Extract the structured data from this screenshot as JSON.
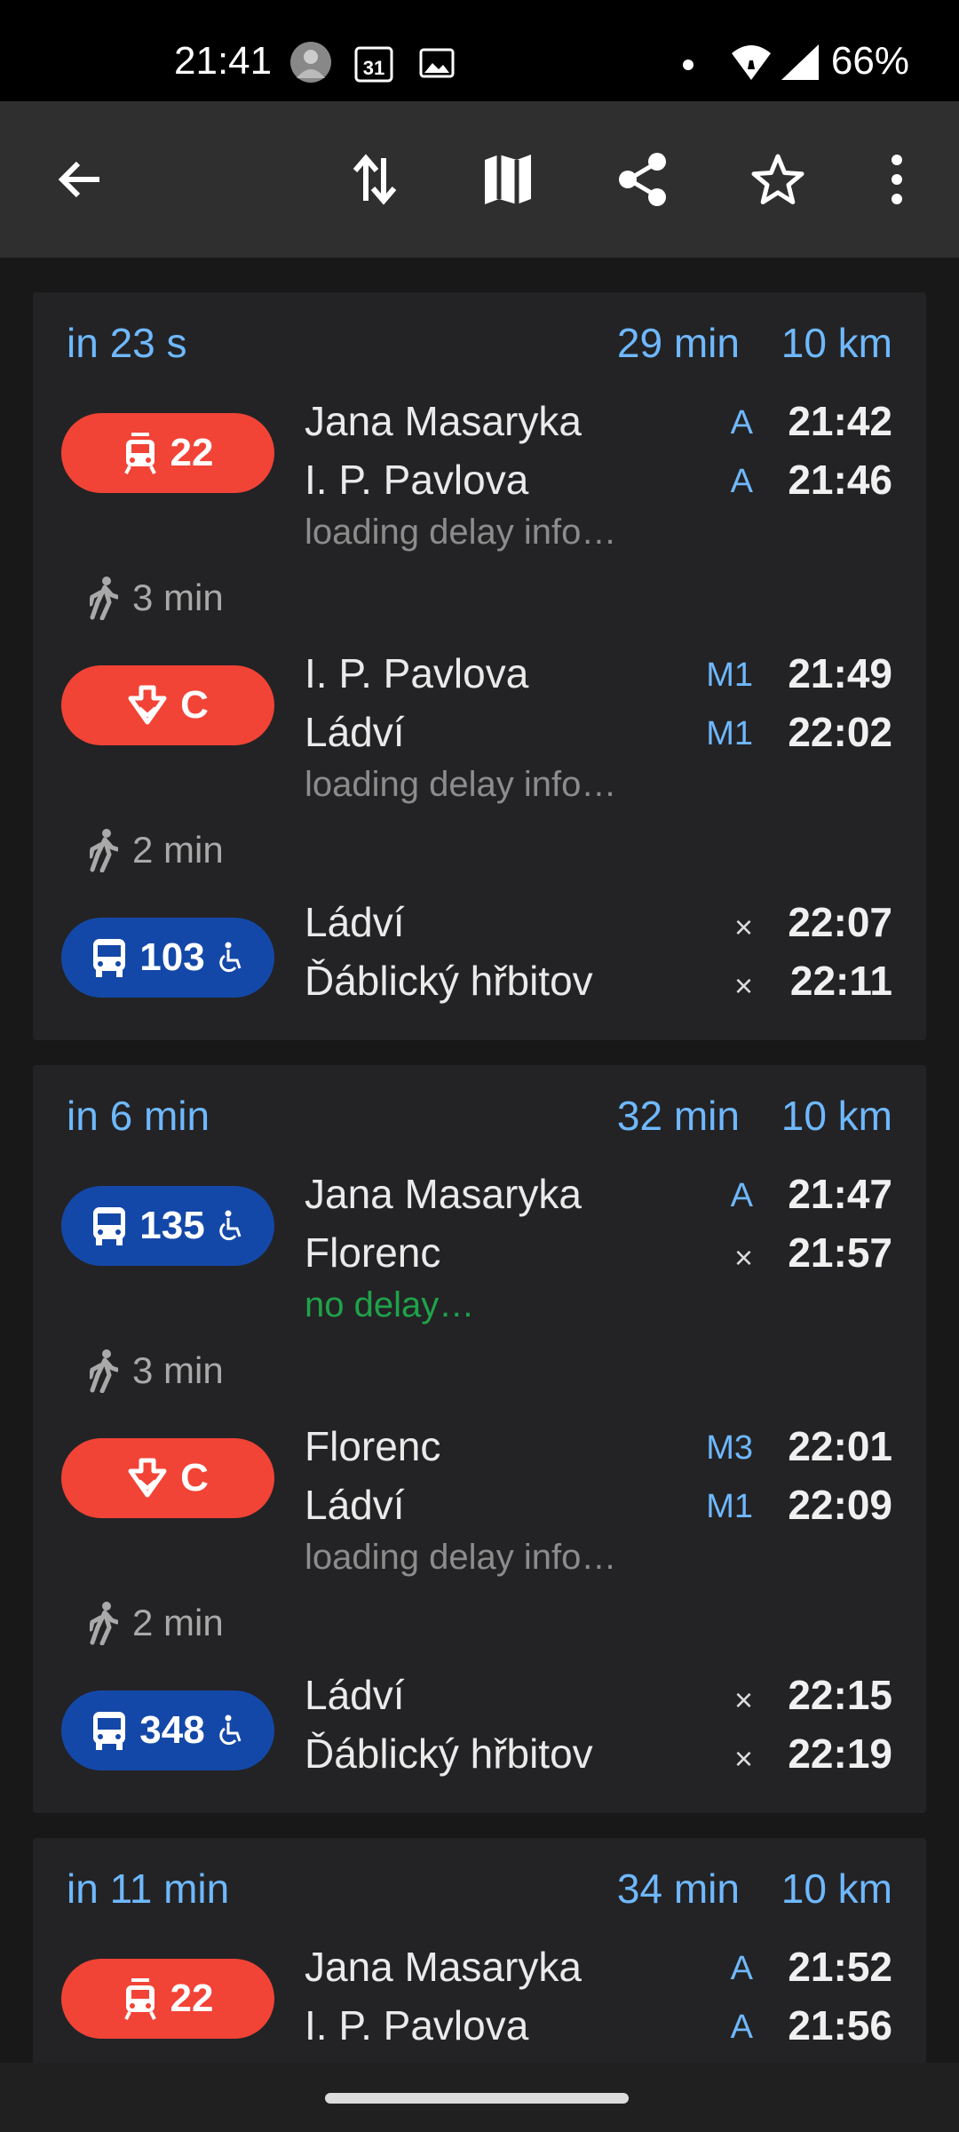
{
  "status_bar": {
    "time": "21:41",
    "calendar_day": "31",
    "battery": "66%",
    "icons": [
      "avatar-icon",
      "calendar-icon",
      "image-icon",
      "notification-dot-icon",
      "wifi-icon",
      "signal-icon"
    ]
  },
  "toolbar": {
    "icons": [
      "back-arrow-icon",
      "swap-icon",
      "map-icon",
      "share-icon",
      "star-icon",
      "more-vert-icon"
    ]
  },
  "colors": {
    "accent": "#6fb8ff",
    "tram_metro": "#f24337",
    "bus": "#1448a8",
    "on_time": "#1fa24a"
  },
  "connections": [
    {
      "in": "in 23 s",
      "duration": "29 min",
      "distance": "10 km",
      "legs": [
        {
          "type": "tram",
          "line": "22",
          "color": "red",
          "accessible": false,
          "from": "Jana Masaryka",
          "from_platform": "A",
          "dep": "21:42",
          "to": "I. P. Pavlova",
          "to_platform": "A",
          "arr": "21:46",
          "note": "loading delay info…",
          "walk_after": "3 min"
        },
        {
          "type": "metro",
          "line": "C",
          "color": "red",
          "accessible": false,
          "from": "I. P. Pavlova",
          "from_platform": "M1",
          "dep": "21:49",
          "to": "Ládví",
          "to_platform": "M1",
          "arr": "22:02",
          "note": "loading delay info…",
          "walk_after": "2 min"
        },
        {
          "type": "bus",
          "line": "103",
          "color": "blue",
          "accessible": true,
          "from": "Ládví",
          "from_platform": "×",
          "dep": "22:07",
          "to": "Ďáblický hřbitov",
          "to_platform": "×",
          "arr": "22:11"
        }
      ]
    },
    {
      "in": "in 6 min",
      "duration": "32 min",
      "distance": "10 km",
      "legs": [
        {
          "type": "bus",
          "line": "135",
          "color": "blue",
          "accessible": true,
          "from": "Jana Masaryka",
          "from_platform": "A",
          "dep": "21:47",
          "to": "Florenc",
          "to_platform": "×",
          "arr": "21:57",
          "note": "no delay…",
          "note_ok": true,
          "walk_after": "3 min"
        },
        {
          "type": "metro",
          "line": "C",
          "color": "red",
          "accessible": false,
          "from": "Florenc",
          "from_platform": "M3",
          "dep": "22:01",
          "to": "Ládví",
          "to_platform": "M1",
          "arr": "22:09",
          "note": "loading delay info…",
          "walk_after": "2 min"
        },
        {
          "type": "bus",
          "line": "348",
          "color": "blue",
          "accessible": true,
          "from": "Ládví",
          "from_platform": "×",
          "dep": "22:15",
          "to": "Ďáblický hřbitov",
          "to_platform": "×",
          "arr": "22:19"
        }
      ]
    },
    {
      "in": "in 11 min",
      "duration": "34 min",
      "distance": "10 km",
      "legs": [
        {
          "type": "tram",
          "line": "22",
          "color": "red",
          "accessible": false,
          "from": "Jana Masaryka",
          "from_platform": "A",
          "dep": "21:52",
          "to": "I. P. Pavlova",
          "to_platform": "A",
          "arr": "21:56"
        }
      ]
    }
  ]
}
